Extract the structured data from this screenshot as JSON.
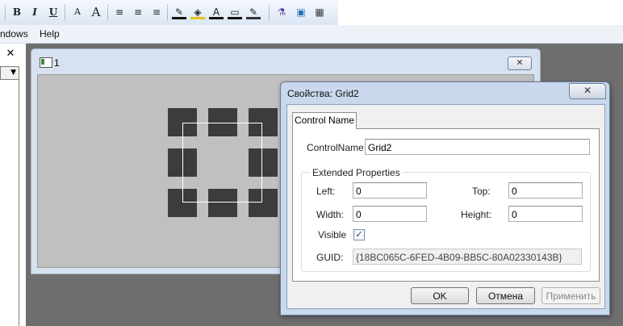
{
  "toolbar": {
    "buttons": [
      {
        "label": "B",
        "icon": "bold-icon"
      },
      {
        "label": "I",
        "icon": "italic-icon"
      },
      {
        "label": "U",
        "icon": "underline-icon"
      },
      {
        "label": "A",
        "icon": "font-decrease-icon"
      },
      {
        "label": "A",
        "icon": "font-increase-icon"
      },
      {
        "label": "≡",
        "icon": "align-left-icon"
      },
      {
        "label": "≡",
        "icon": "align-center-icon"
      },
      {
        "label": "≡",
        "icon": "align-right-icon"
      },
      {
        "label": "✎",
        "icon": "line-color-icon"
      },
      {
        "label": "◈",
        "icon": "fill-color-icon"
      },
      {
        "label": "A",
        "icon": "font-color-icon"
      },
      {
        "label": "▭",
        "icon": "border-icon"
      },
      {
        "label": "✎",
        "icon": "line-style-icon"
      },
      {
        "label": "⚗",
        "icon": "wizard-icon"
      },
      {
        "label": "▣",
        "icon": "grid-icon"
      },
      {
        "label": "▦",
        "icon": "properties-icon"
      }
    ]
  },
  "menubar": {
    "windows_label": "ndows",
    "help_label": "Help"
  },
  "left_panel": {
    "close_label": "✕",
    "combo_arrow": "▼"
  },
  "document": {
    "title": "1",
    "close_label": "✕"
  },
  "dialog": {
    "title": "Свойства: Grid2",
    "close_label": "✕",
    "tab_label": "Control Name",
    "control_name_label": "ControlName:",
    "control_name_value": "Grid2",
    "group_label": "Extended Properties",
    "left_label": "Left:",
    "left_value": "0",
    "top_label": "Top:",
    "top_value": "0",
    "width_label": "Width:",
    "width_value": "0",
    "height_label": "Height:",
    "height_value": "0",
    "visible_label": "Visible",
    "visible_checked": true,
    "visible_mark": "✓",
    "guid_label": "GUID:",
    "guid_value": "{18BC065C-6FED-4B09-BB5C-80A02330143B}",
    "ok_label": "OK",
    "cancel_label": "Отмена",
    "apply_label": "Применить"
  },
  "colors": {
    "workspace": "#6e6e6e",
    "canvas": "#c0c0c0",
    "selection_handles": "#3c3c3c",
    "dialog_frame": "#c9d8ec"
  }
}
